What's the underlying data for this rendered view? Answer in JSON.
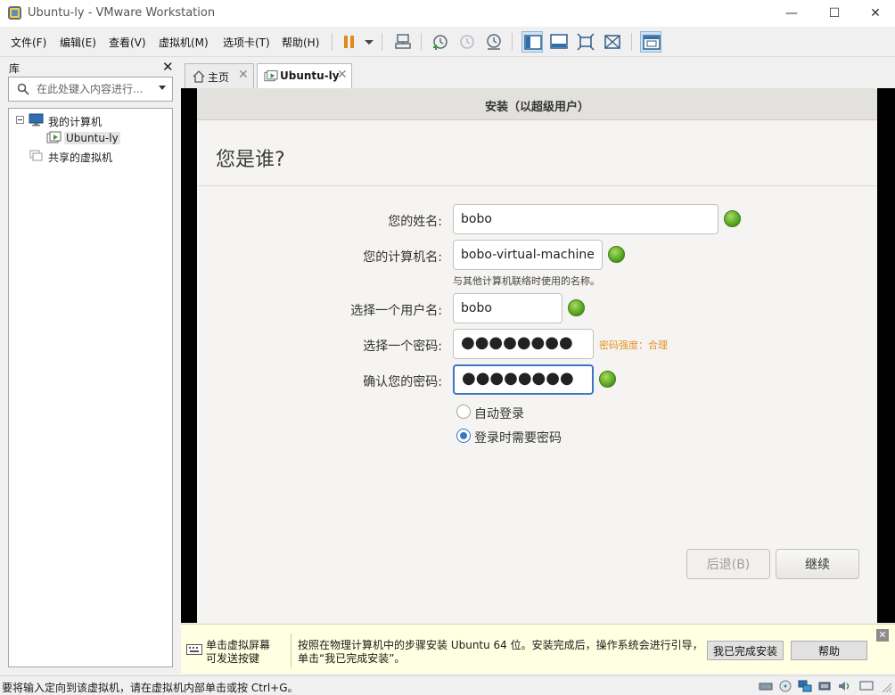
{
  "window": {
    "title": "Ubuntu-ly - VMware Workstation",
    "minimize": "—",
    "maximize": "☐",
    "close": "✕"
  },
  "menu": [
    "文件(F)",
    "编辑(E)",
    "查看(V)",
    "虚拟机(M)",
    "选项卡(T)",
    "帮助(H)"
  ],
  "library": {
    "title": "库",
    "close": "✕",
    "search_placeholder": "在此处键入内容进行...",
    "tree": {
      "my_computer": "我的计算机",
      "vm": "Ubuntu-ly",
      "shared": "共享的虚拟机"
    }
  },
  "tabs": [
    {
      "label": "主页",
      "close": "✕"
    },
    {
      "label": "Ubuntu-ly",
      "close": "✕"
    }
  ],
  "installer": {
    "header": "安装（以超级用户）",
    "title": "您是谁?",
    "name_label": "您的姓名:",
    "name_value": "bobo",
    "computer_label": "您的计算机名:",
    "computer_value": "bobo-virtual-machine",
    "computer_hint": "与其他计算机联络时使用的名称。",
    "username_label": "选择一个用户名:",
    "username_value": "bobo",
    "password_label": "选择一个密码:",
    "password_mask": "●●●●●●●●",
    "strength": "密码强度：合理",
    "confirm_label": "确认您的密码:",
    "confirm_mask": "●●●●●●●●",
    "auto_login": "自动登录",
    "require_password": "登录时需要密码",
    "back_button": "后退(B)",
    "continue_button": "继续"
  },
  "hint_bar": {
    "left_line1": "单击虚拟屏幕",
    "left_line2": "可发送按键",
    "main_line1": "按照在物理计算机中的步骤安装 Ubuntu 64 位。安装完成后，操作系统会进行引导，",
    "main_line2": "单击“我已完成安装”。",
    "done_button": "我已完成安装",
    "help_button": "帮助",
    "close": "✕"
  },
  "status": {
    "text": "要将输入定向到该虚拟机，请在虚拟机内部单击或按 Ctrl+G。"
  },
  "colors": {
    "accent": "#3a76c4",
    "ok_green": "#4a9a1a",
    "strength_orange": "#e5921c",
    "hint_bg": "#ffffe1"
  }
}
